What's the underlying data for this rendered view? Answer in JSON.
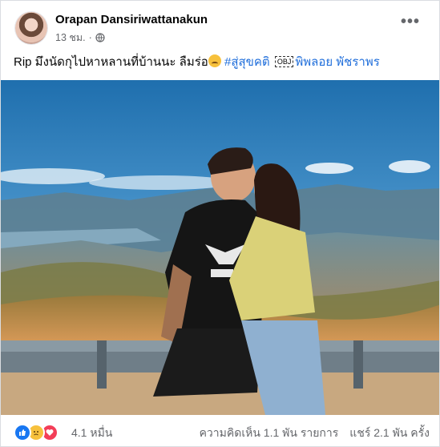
{
  "post": {
    "author": "Orapan Dansiriwattanakun",
    "time": "13 ชม.",
    "privacy_icon": "globe-icon",
    "more_icon": "more-options-icon",
    "caption_text": "Rip มึงนัดกุไปหาหลานที่บ้านนะ ลืมร่อ",
    "caption_emoji": "sad-face-emoji",
    "hashtag": "#สู่สุขคติ",
    "obj_marker": "OBJ",
    "mention": "พิพลอย พัชราพร"
  },
  "footer": {
    "reaction_icons": [
      "like-icon",
      "sad-icon",
      "love-icon"
    ],
    "reaction_count": "4.1 หมื่น",
    "comments": "ความคิดเห็น 1.1 พัน รายการ",
    "shares": "แชร์ 2.1 พัน ครั้ง"
  },
  "colors": {
    "link": "#216fdb",
    "secondary_text": "#65676b",
    "like": "#1877f2",
    "love": "#f33e58",
    "sad": "#f7c13c"
  }
}
